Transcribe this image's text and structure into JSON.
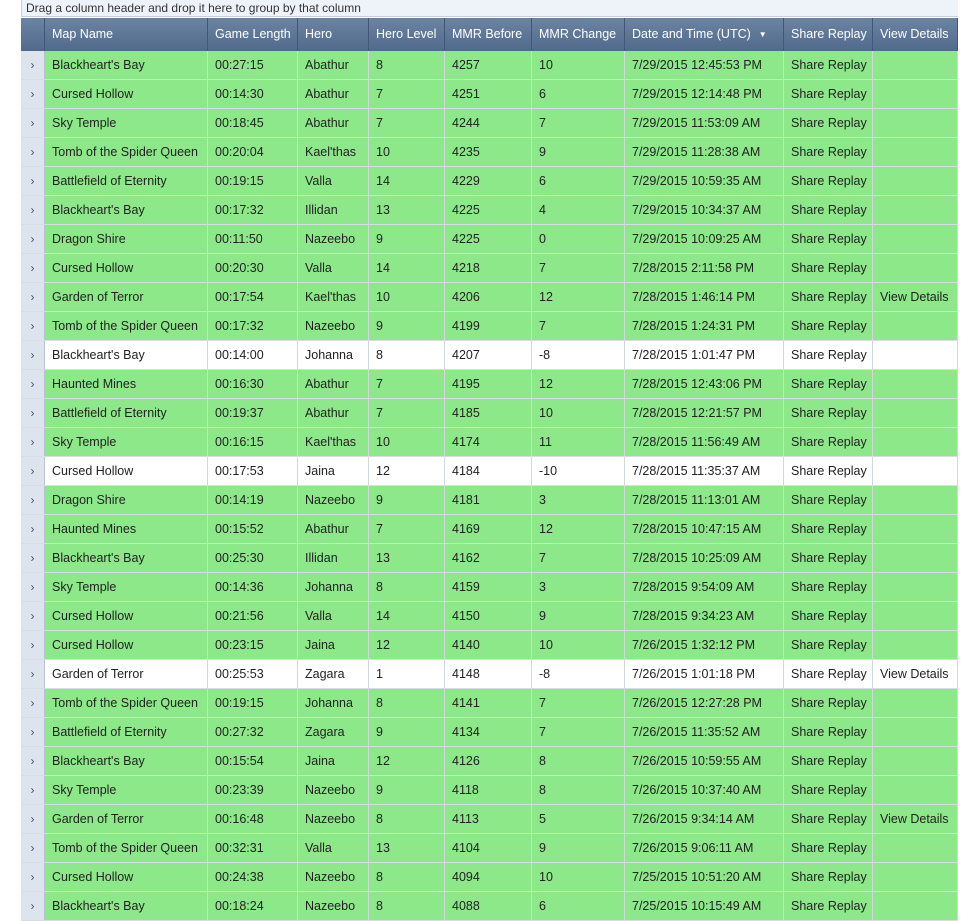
{
  "group_panel": {
    "text": "Drag a column header and drop it here to group by that column"
  },
  "columns": {
    "map": "Map Name",
    "length": "Game Length",
    "hero": "Hero",
    "level": "Hero Level",
    "mmr_before": "MMR Before",
    "mmr_change": "MMR Change",
    "date": "Date and Time (UTC)",
    "share": "Share Replay",
    "view": "View Details"
  },
  "sort": {
    "column": "date",
    "direction": "descending",
    "indicator_icon": "sort-descending-icon"
  },
  "row_indicator_glyph": "›",
  "colors": {
    "win_row": "#8de88a",
    "loss_row": "#ffffff",
    "header": "#5d7596"
  },
  "rows": [
    {
      "map": "Blackheart's Bay",
      "length": "00:27:15",
      "hero": "Abathur",
      "level": "8",
      "mmr_before": "4257",
      "mmr_change": "10",
      "date": "7/29/2015 12:45:53 PM",
      "share": "Share Replay",
      "view": "",
      "result": "win"
    },
    {
      "map": "Cursed Hollow",
      "length": "00:14:30",
      "hero": "Abathur",
      "level": "7",
      "mmr_before": "4251",
      "mmr_change": "6",
      "date": "7/29/2015 12:14:48 PM",
      "share": "Share Replay",
      "view": "",
      "result": "win"
    },
    {
      "map": "Sky Temple",
      "length": "00:18:45",
      "hero": "Abathur",
      "level": "7",
      "mmr_before": "4244",
      "mmr_change": "7",
      "date": "7/29/2015 11:53:09 AM",
      "share": "Share Replay",
      "view": "",
      "result": "win"
    },
    {
      "map": "Tomb of the Spider Queen",
      "length": "00:20:04",
      "hero": "Kael'thas",
      "level": "10",
      "mmr_before": "4235",
      "mmr_change": "9",
      "date": "7/29/2015 11:28:38 AM",
      "share": "Share Replay",
      "view": "",
      "result": "win"
    },
    {
      "map": "Battlefield of Eternity",
      "length": "00:19:15",
      "hero": "Valla",
      "level": "14",
      "mmr_before": "4229",
      "mmr_change": "6",
      "date": "7/29/2015 10:59:35 AM",
      "share": "Share Replay",
      "view": "",
      "result": "win"
    },
    {
      "map": "Blackheart's Bay",
      "length": "00:17:32",
      "hero": "Illidan",
      "level": "13",
      "mmr_before": "4225",
      "mmr_change": "4",
      "date": "7/29/2015 10:34:37 AM",
      "share": "Share Replay",
      "view": "",
      "result": "win"
    },
    {
      "map": "Dragon Shire",
      "length": "00:11:50",
      "hero": "Nazeebo",
      "level": "9",
      "mmr_before": "4225",
      "mmr_change": "0",
      "date": "7/29/2015 10:09:25 AM",
      "share": "Share Replay",
      "view": "",
      "result": "win"
    },
    {
      "map": "Cursed Hollow",
      "length": "00:20:30",
      "hero": "Valla",
      "level": "14",
      "mmr_before": "4218",
      "mmr_change": "7",
      "date": "7/28/2015 2:11:58 PM",
      "share": "Share Replay",
      "view": "",
      "result": "win"
    },
    {
      "map": "Garden of Terror",
      "length": "00:17:54",
      "hero": "Kael'thas",
      "level": "10",
      "mmr_before": "4206",
      "mmr_change": "12",
      "date": "7/28/2015 1:46:14 PM",
      "share": "Share Replay",
      "view": "View Details",
      "result": "win"
    },
    {
      "map": "Tomb of the Spider Queen",
      "length": "00:17:32",
      "hero": "Nazeebo",
      "level": "9",
      "mmr_before": "4199",
      "mmr_change": "7",
      "date": "7/28/2015 1:24:31 PM",
      "share": "Share Replay",
      "view": "",
      "result": "win"
    },
    {
      "map": "Blackheart's Bay",
      "length": "00:14:00",
      "hero": "Johanna",
      "level": "8",
      "mmr_before": "4207",
      "mmr_change": "-8",
      "date": "7/28/2015 1:01:47 PM",
      "share": "Share Replay",
      "view": "",
      "result": "loss"
    },
    {
      "map": "Haunted Mines",
      "length": "00:16:30",
      "hero": "Abathur",
      "level": "7",
      "mmr_before": "4195",
      "mmr_change": "12",
      "date": "7/28/2015 12:43:06 PM",
      "share": "Share Replay",
      "view": "",
      "result": "win"
    },
    {
      "map": "Battlefield of Eternity",
      "length": "00:19:37",
      "hero": "Abathur",
      "level": "7",
      "mmr_before": "4185",
      "mmr_change": "10",
      "date": "7/28/2015 12:21:57 PM",
      "share": "Share Replay",
      "view": "",
      "result": "win"
    },
    {
      "map": "Sky Temple",
      "length": "00:16:15",
      "hero": "Kael'thas",
      "level": "10",
      "mmr_before": "4174",
      "mmr_change": "11",
      "date": "7/28/2015 11:56:49 AM",
      "share": "Share Replay",
      "view": "",
      "result": "win"
    },
    {
      "map": "Cursed Hollow",
      "length": "00:17:53",
      "hero": "Jaina",
      "level": "12",
      "mmr_before": "4184",
      "mmr_change": "-10",
      "date": "7/28/2015 11:35:37 AM",
      "share": "Share Replay",
      "view": "",
      "result": "loss"
    },
    {
      "map": "Dragon Shire",
      "length": "00:14:19",
      "hero": "Nazeebo",
      "level": "9",
      "mmr_before": "4181",
      "mmr_change": "3",
      "date": "7/28/2015 11:13:01 AM",
      "share": "Share Replay",
      "view": "",
      "result": "win"
    },
    {
      "map": "Haunted Mines",
      "length": "00:15:52",
      "hero": "Abathur",
      "level": "7",
      "mmr_before": "4169",
      "mmr_change": "12",
      "date": "7/28/2015 10:47:15 AM",
      "share": "Share Replay",
      "view": "",
      "result": "win"
    },
    {
      "map": "Blackheart's Bay",
      "length": "00:25:30",
      "hero": "Illidan",
      "level": "13",
      "mmr_before": "4162",
      "mmr_change": "7",
      "date": "7/28/2015 10:25:09 AM",
      "share": "Share Replay",
      "view": "",
      "result": "win"
    },
    {
      "map": "Sky Temple",
      "length": "00:14:36",
      "hero": "Johanna",
      "level": "8",
      "mmr_before": "4159",
      "mmr_change": "3",
      "date": "7/28/2015 9:54:09 AM",
      "share": "Share Replay",
      "view": "",
      "result": "win"
    },
    {
      "map": "Cursed Hollow",
      "length": "00:21:56",
      "hero": "Valla",
      "level": "14",
      "mmr_before": "4150",
      "mmr_change": "9",
      "date": "7/28/2015 9:34:23 AM",
      "share": "Share Replay",
      "view": "",
      "result": "win"
    },
    {
      "map": "Cursed Hollow",
      "length": "00:23:15",
      "hero": "Jaina",
      "level": "12",
      "mmr_before": "4140",
      "mmr_change": "10",
      "date": "7/26/2015 1:32:12 PM",
      "share": "Share Replay",
      "view": "",
      "result": "win"
    },
    {
      "map": "Garden of Terror",
      "length": "00:25:53",
      "hero": "Zagara",
      "level": "1",
      "mmr_before": "4148",
      "mmr_change": "-8",
      "date": "7/26/2015 1:01:18 PM",
      "share": "Share Replay",
      "view": "View Details",
      "result": "loss"
    },
    {
      "map": "Tomb of the Spider Queen",
      "length": "00:19:15",
      "hero": "Johanna",
      "level": "8",
      "mmr_before": "4141",
      "mmr_change": "7",
      "date": "7/26/2015 12:27:28 PM",
      "share": "Share Replay",
      "view": "",
      "result": "win"
    },
    {
      "map": "Battlefield of Eternity",
      "length": "00:27:32",
      "hero": "Zagara",
      "level": "9",
      "mmr_before": "4134",
      "mmr_change": "7",
      "date": "7/26/2015 11:35:52 AM",
      "share": "Share Replay",
      "view": "",
      "result": "win"
    },
    {
      "map": "Blackheart's Bay",
      "length": "00:15:54",
      "hero": "Jaina",
      "level": "12",
      "mmr_before": "4126",
      "mmr_change": "8",
      "date": "7/26/2015 10:59:55 AM",
      "share": "Share Replay",
      "view": "",
      "result": "win"
    },
    {
      "map": "Sky Temple",
      "length": "00:23:39",
      "hero": "Nazeebo",
      "level": "9",
      "mmr_before": "4118",
      "mmr_change": "8",
      "date": "7/26/2015 10:37:40 AM",
      "share": "Share Replay",
      "view": "",
      "result": "win"
    },
    {
      "map": "Garden of Terror",
      "length": "00:16:48",
      "hero": "Nazeebo",
      "level": "8",
      "mmr_before": "4113",
      "mmr_change": "5",
      "date": "7/26/2015 9:34:14 AM",
      "share": "Share Replay",
      "view": "View Details",
      "result": "win"
    },
    {
      "map": "Tomb of the Spider Queen",
      "length": "00:32:31",
      "hero": "Valla",
      "level": "13",
      "mmr_before": "4104",
      "mmr_change": "9",
      "date": "7/26/2015 9:06:11 AM",
      "share": "Share Replay",
      "view": "",
      "result": "win"
    },
    {
      "map": "Cursed Hollow",
      "length": "00:24:38",
      "hero": "Nazeebo",
      "level": "8",
      "mmr_before": "4094",
      "mmr_change": "10",
      "date": "7/25/2015 10:51:20 AM",
      "share": "Share Replay",
      "view": "",
      "result": "win"
    },
    {
      "map": "Blackheart's Bay",
      "length": "00:18:24",
      "hero": "Nazeebo",
      "level": "8",
      "mmr_before": "4088",
      "mmr_change": "6",
      "date": "7/25/2015 10:15:49 AM",
      "share": "Share Replay",
      "view": "",
      "result": "win"
    }
  ]
}
